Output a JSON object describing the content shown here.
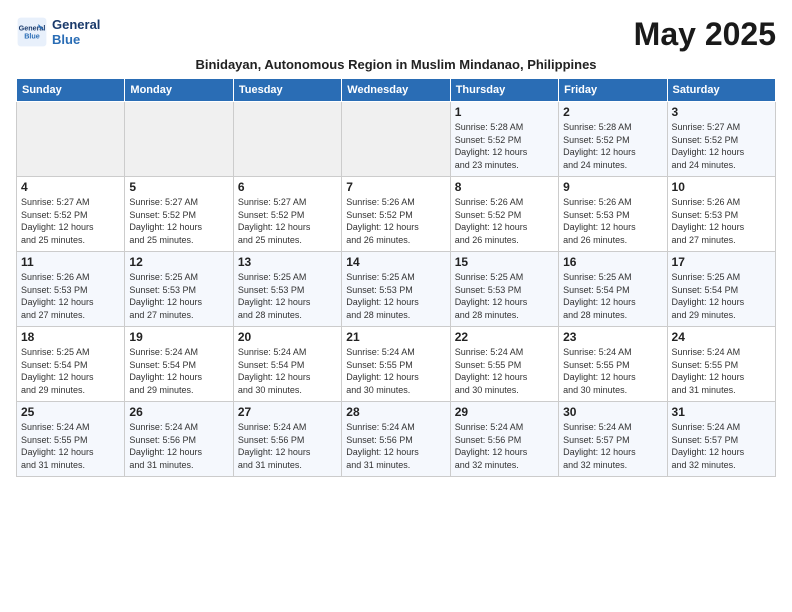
{
  "header": {
    "logo_line1": "General",
    "logo_line2": "Blue",
    "month_title": "May 2025",
    "subtitle": "Binidayan, Autonomous Region in Muslim Mindanao, Philippines"
  },
  "days_of_week": [
    "Sunday",
    "Monday",
    "Tuesday",
    "Wednesday",
    "Thursday",
    "Friday",
    "Saturday"
  ],
  "weeks": [
    [
      {
        "day": "",
        "info": ""
      },
      {
        "day": "",
        "info": ""
      },
      {
        "day": "",
        "info": ""
      },
      {
        "day": "",
        "info": ""
      },
      {
        "day": "1",
        "info": "Sunrise: 5:28 AM\nSunset: 5:52 PM\nDaylight: 12 hours\nand 23 minutes."
      },
      {
        "day": "2",
        "info": "Sunrise: 5:28 AM\nSunset: 5:52 PM\nDaylight: 12 hours\nand 24 minutes."
      },
      {
        "day": "3",
        "info": "Sunrise: 5:27 AM\nSunset: 5:52 PM\nDaylight: 12 hours\nand 24 minutes."
      }
    ],
    [
      {
        "day": "4",
        "info": "Sunrise: 5:27 AM\nSunset: 5:52 PM\nDaylight: 12 hours\nand 25 minutes."
      },
      {
        "day": "5",
        "info": "Sunrise: 5:27 AM\nSunset: 5:52 PM\nDaylight: 12 hours\nand 25 minutes."
      },
      {
        "day": "6",
        "info": "Sunrise: 5:27 AM\nSunset: 5:52 PM\nDaylight: 12 hours\nand 25 minutes."
      },
      {
        "day": "7",
        "info": "Sunrise: 5:26 AM\nSunset: 5:52 PM\nDaylight: 12 hours\nand 26 minutes."
      },
      {
        "day": "8",
        "info": "Sunrise: 5:26 AM\nSunset: 5:52 PM\nDaylight: 12 hours\nand 26 minutes."
      },
      {
        "day": "9",
        "info": "Sunrise: 5:26 AM\nSunset: 5:53 PM\nDaylight: 12 hours\nand 26 minutes."
      },
      {
        "day": "10",
        "info": "Sunrise: 5:26 AM\nSunset: 5:53 PM\nDaylight: 12 hours\nand 27 minutes."
      }
    ],
    [
      {
        "day": "11",
        "info": "Sunrise: 5:26 AM\nSunset: 5:53 PM\nDaylight: 12 hours\nand 27 minutes."
      },
      {
        "day": "12",
        "info": "Sunrise: 5:25 AM\nSunset: 5:53 PM\nDaylight: 12 hours\nand 27 minutes."
      },
      {
        "day": "13",
        "info": "Sunrise: 5:25 AM\nSunset: 5:53 PM\nDaylight: 12 hours\nand 28 minutes."
      },
      {
        "day": "14",
        "info": "Sunrise: 5:25 AM\nSunset: 5:53 PM\nDaylight: 12 hours\nand 28 minutes."
      },
      {
        "day": "15",
        "info": "Sunrise: 5:25 AM\nSunset: 5:53 PM\nDaylight: 12 hours\nand 28 minutes."
      },
      {
        "day": "16",
        "info": "Sunrise: 5:25 AM\nSunset: 5:54 PM\nDaylight: 12 hours\nand 28 minutes."
      },
      {
        "day": "17",
        "info": "Sunrise: 5:25 AM\nSunset: 5:54 PM\nDaylight: 12 hours\nand 29 minutes."
      }
    ],
    [
      {
        "day": "18",
        "info": "Sunrise: 5:25 AM\nSunset: 5:54 PM\nDaylight: 12 hours\nand 29 minutes."
      },
      {
        "day": "19",
        "info": "Sunrise: 5:24 AM\nSunset: 5:54 PM\nDaylight: 12 hours\nand 29 minutes."
      },
      {
        "day": "20",
        "info": "Sunrise: 5:24 AM\nSunset: 5:54 PM\nDaylight: 12 hours\nand 30 minutes."
      },
      {
        "day": "21",
        "info": "Sunrise: 5:24 AM\nSunset: 5:55 PM\nDaylight: 12 hours\nand 30 minutes."
      },
      {
        "day": "22",
        "info": "Sunrise: 5:24 AM\nSunset: 5:55 PM\nDaylight: 12 hours\nand 30 minutes."
      },
      {
        "day": "23",
        "info": "Sunrise: 5:24 AM\nSunset: 5:55 PM\nDaylight: 12 hours\nand 30 minutes."
      },
      {
        "day": "24",
        "info": "Sunrise: 5:24 AM\nSunset: 5:55 PM\nDaylight: 12 hours\nand 31 minutes."
      }
    ],
    [
      {
        "day": "25",
        "info": "Sunrise: 5:24 AM\nSunset: 5:55 PM\nDaylight: 12 hours\nand 31 minutes."
      },
      {
        "day": "26",
        "info": "Sunrise: 5:24 AM\nSunset: 5:56 PM\nDaylight: 12 hours\nand 31 minutes."
      },
      {
        "day": "27",
        "info": "Sunrise: 5:24 AM\nSunset: 5:56 PM\nDaylight: 12 hours\nand 31 minutes."
      },
      {
        "day": "28",
        "info": "Sunrise: 5:24 AM\nSunset: 5:56 PM\nDaylight: 12 hours\nand 31 minutes."
      },
      {
        "day": "29",
        "info": "Sunrise: 5:24 AM\nSunset: 5:56 PM\nDaylight: 12 hours\nand 32 minutes."
      },
      {
        "day": "30",
        "info": "Sunrise: 5:24 AM\nSunset: 5:57 PM\nDaylight: 12 hours\nand 32 minutes."
      },
      {
        "day": "31",
        "info": "Sunrise: 5:24 AM\nSunset: 5:57 PM\nDaylight: 12 hours\nand 32 minutes."
      }
    ]
  ]
}
